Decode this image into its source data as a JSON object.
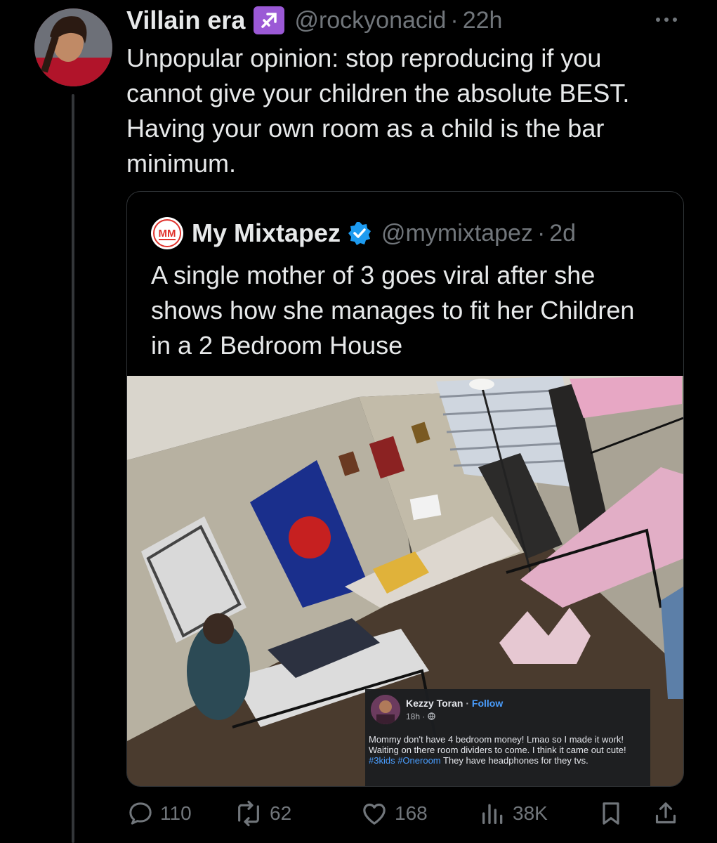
{
  "tweet": {
    "display_name": "Villain era",
    "zodiac_icon": "sagittarius-emoji",
    "handle": "@rockyonacid",
    "time": "22h",
    "text": "Unpopular opinion: stop reproducing if you cannot give your children the absolute BEST. Having your own room as a child is the bar minimum."
  },
  "quote": {
    "logo_icon": "mymixtapez-logo",
    "display_name": "My Mixtapez",
    "verified_icon": "verified-badge-icon",
    "handle": "@mymixtapez",
    "time": "2d",
    "text": "A single mother of 3 goes viral after she shows how she manages to fit her Children in a 2 Bedroom House",
    "fb_post": {
      "name": "Kezzy Toran",
      "follow_label": "Follow",
      "time": "18h ·",
      "text_before": "Mommy don't have 4 bedroom money! Lmao so I made it work! Waiting on there room dividers to come. I think it came out cute! ",
      "hashtag1": "#3kids",
      "hashtag2": "#Oneroom",
      "text_after": " They have headphones for they tvs."
    }
  },
  "actions": {
    "replies": "110",
    "retweets": "62",
    "likes": "168",
    "views": "38K"
  },
  "colors": {
    "background": "#000000",
    "text": "#e7e9ea",
    "secondary": "#71767b",
    "verified": "#1d9bf0",
    "zodiac": "#9b59d6",
    "fb_link": "#4a9eff"
  }
}
